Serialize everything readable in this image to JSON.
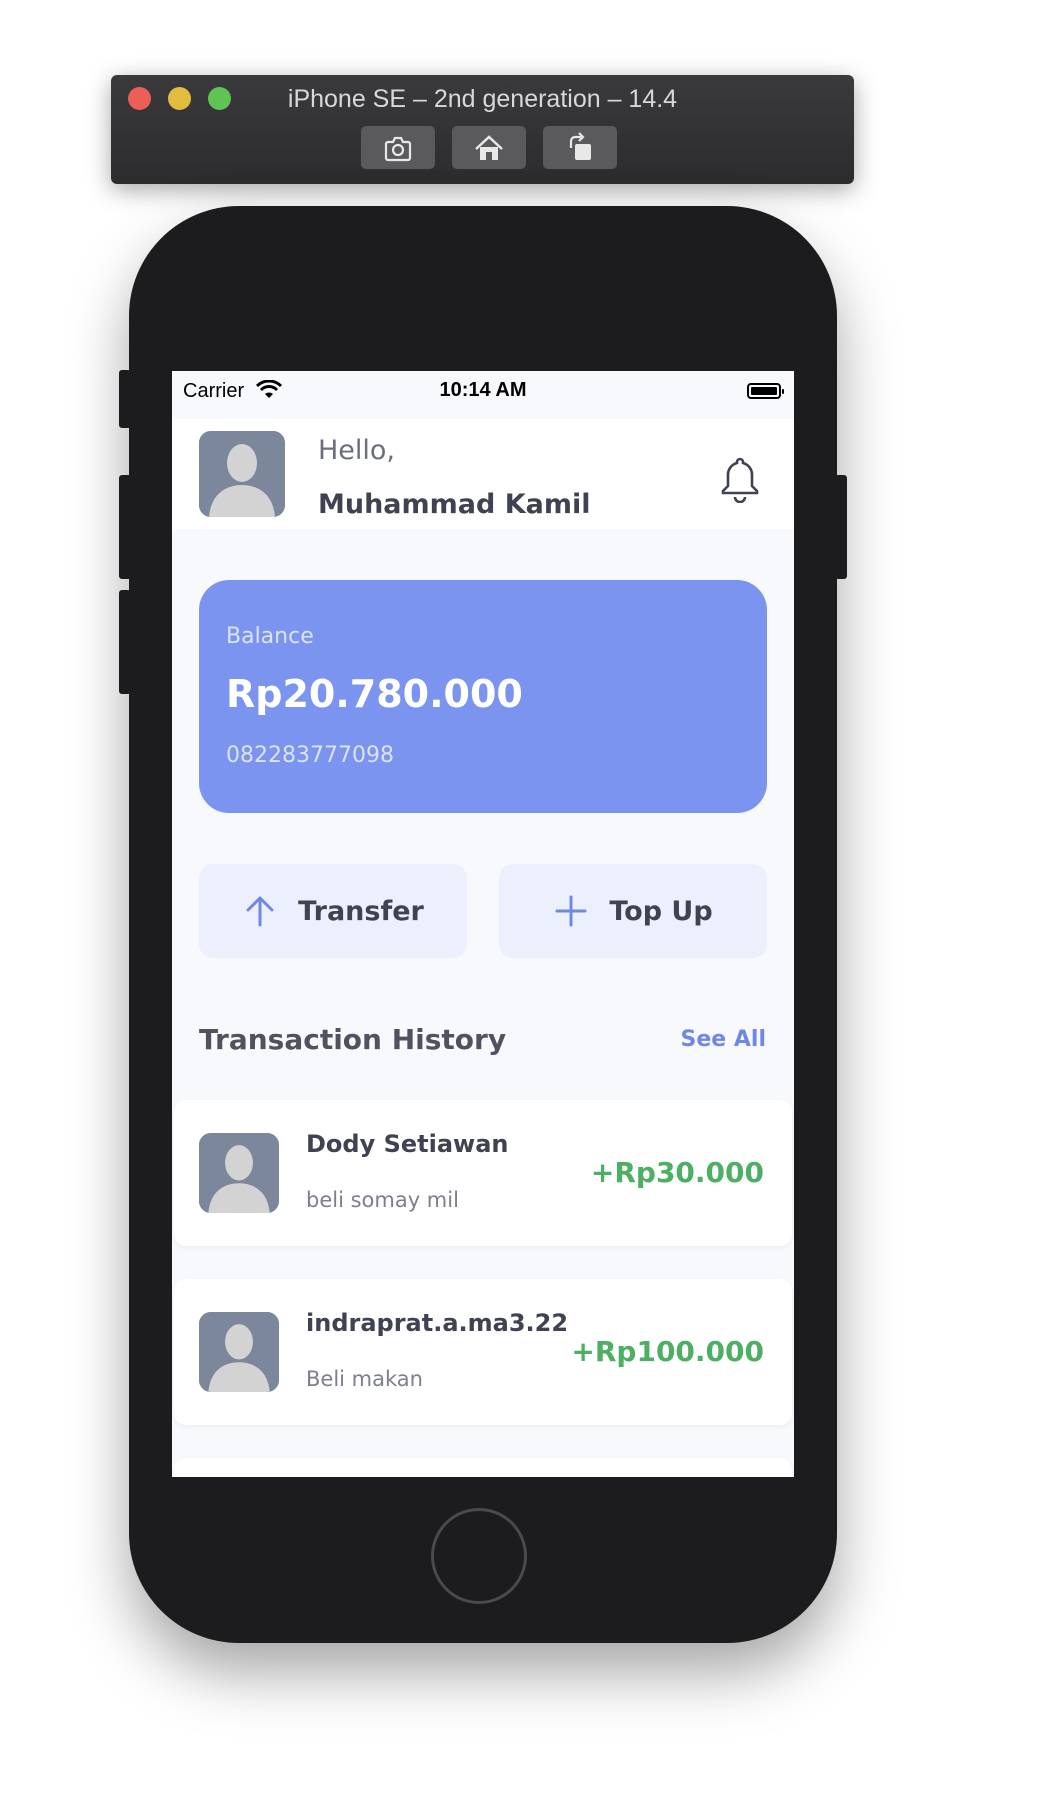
{
  "simulator": {
    "title": "iPhone SE – 2nd generation – 14.4",
    "buttons": [
      "screenshot",
      "home",
      "rotate"
    ]
  },
  "status_bar": {
    "carrier": "Carrier",
    "time": "10:14 AM"
  },
  "header": {
    "greeting": "Hello,",
    "user_name": "Muhammad Kamil",
    "notification_icon": "bell-icon"
  },
  "balance_card": {
    "label": "Balance",
    "amount": "Rp20.780.000",
    "phone": "082283777098",
    "color": "#7b94ef"
  },
  "actions": [
    {
      "label": "Transfer",
      "icon": "arrow-up-icon"
    },
    {
      "label": "Top Up",
      "icon": "plus-icon"
    }
  ],
  "transactions_section": {
    "title": "Transaction History",
    "see_all": "See All"
  },
  "transactions": [
    {
      "name": "Dody Setiawan",
      "note": "beli somay mil",
      "amount": "+Rp30.000"
    },
    {
      "name": "indraprat.a.ma3.22...",
      "note": "Beli makan",
      "amount": "+Rp100.000"
    }
  ],
  "colors": {
    "accent": "#6f88e4",
    "positive": "#4caf64",
    "button_bg": "#ecf0fc"
  }
}
